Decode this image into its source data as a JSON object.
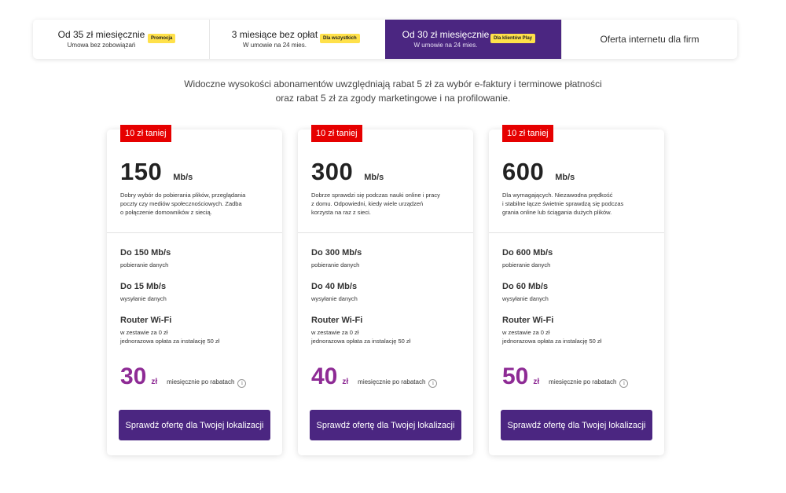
{
  "tabs": [
    {
      "title": "Od 35 zł miesięcznie",
      "subtitle": "Umowa bez zobowiązań",
      "badge": "Promocja",
      "active": false
    },
    {
      "title": "3 miesiące bez opłat",
      "subtitle": "W umowie na 24 mies.",
      "badge": "Dla wszystkich",
      "active": false
    },
    {
      "title": "Od 30 zł miesięcznie",
      "subtitle": "W umowie na 24 mies.",
      "badge": "Dla klientów Play",
      "active": true
    },
    {
      "title": "Oferta internetu dla firm",
      "active": false
    }
  ],
  "disclaimer": {
    "line1": "Widoczne wysokości abonamentów uwzględniają rabat 5 zł za wybór e-faktury i terminowe płatności",
    "line2": "oraz rabat 5 zł za zgody marketingowe i na profilowanie."
  },
  "colors": {
    "brand": "#4b2681",
    "price": "#8e2b95",
    "promo": "#e60000",
    "badge": "#ffe14a"
  },
  "plans": [
    {
      "promo": "10 zł taniej",
      "speed": "150",
      "speed_unit": "Mb/s",
      "desc": [
        "Dobry wybór do pobierania plików, przeglądania",
        "poczty czy mediów społecznościowych. Zadba",
        "o połączenie domowników z siecią."
      ],
      "download": {
        "title": "Do 150 Mb/s",
        "sub": "pobieranie danych"
      },
      "upload": {
        "title": "Do 15 Mb/s",
        "sub": "wysyłanie danych"
      },
      "router": {
        "title": "Router Wi-Fi",
        "sub1": "w zestawie za 0 zł",
        "sub2": "jednorazowa opłata za instalację 50 zł"
      },
      "price": "30",
      "price_unit": "zł",
      "price_label": "miesięcznie po rabatach",
      "info_icon": "info-icon",
      "cta": "Sprawdź ofertę dla Twojej lokalizacji"
    },
    {
      "promo": "10 zł taniej",
      "speed": "300",
      "speed_unit": "Mb/s",
      "desc": [
        "Dobrze sprawdzi się podczas nauki online i pracy",
        "z domu. Odpowiedni, kiedy wiele urządzeń",
        "korzysta na raz z sieci."
      ],
      "download": {
        "title": "Do 300 Mb/s",
        "sub": "pobieranie danych"
      },
      "upload": {
        "title": "Do 40 Mb/s",
        "sub": "wysyłanie danych"
      },
      "router": {
        "title": "Router Wi-Fi",
        "sub1": "w zestawie za 0 zł",
        "sub2": "jednorazowa opłata za instalację 50 zł"
      },
      "price": "40",
      "price_unit": "zł",
      "price_label": "miesięcznie po rabatach",
      "info_icon": "info-icon",
      "cta": "Sprawdź ofertę dla Twojej lokalizacji"
    },
    {
      "promo": "10 zł taniej",
      "speed": "600",
      "speed_unit": "Mb/s",
      "desc": [
        "Dla wymagających. Niezawodna prędkość",
        "i stabilne łącze świetnie sprawdzą się podczas",
        "grania online lub ściągania dużych plików."
      ],
      "download": {
        "title": "Do 600 Mb/s",
        "sub": "pobieranie danych"
      },
      "upload": {
        "title": "Do 60 Mb/s",
        "sub": "wysyłanie danych"
      },
      "router": {
        "title": "Router Wi-Fi",
        "sub1": "w zestawie za 0 zł",
        "sub2": "jednorazowa opłata za instalację 50 zł"
      },
      "price": "50",
      "price_unit": "zł",
      "price_label": "miesięcznie po rabatach",
      "info_icon": "info-icon",
      "cta": "Sprawdź ofertę dla Twojej lokalizacji"
    }
  ]
}
